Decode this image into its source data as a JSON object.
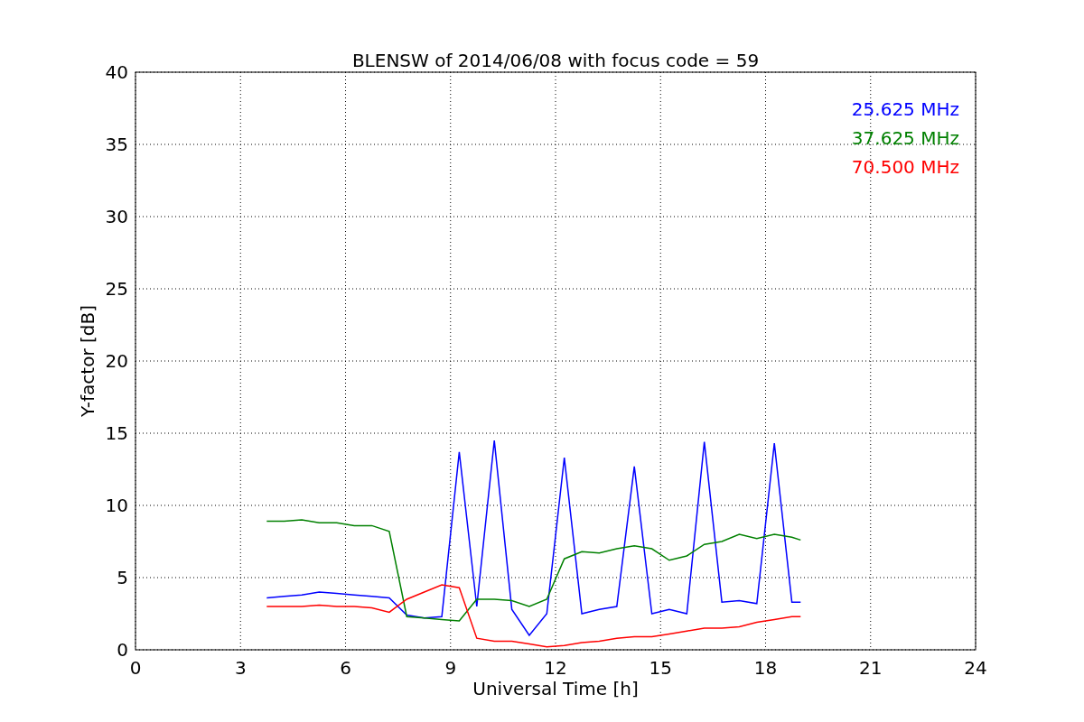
{
  "chart": {
    "chart_data": {
      "type": "line",
      "title": "BLENSW of 2014/06/08 with focus code = 59",
      "xlabel": "Universal Time [h]",
      "ylabel": "Y-factor [dB]",
      "x": [
        3.75,
        4.25,
        4.75,
        5.25,
        5.75,
        6.25,
        6.75,
        7.25,
        7.75,
        8.25,
        8.75,
        9.25,
        9.75,
        10.25,
        10.75,
        11.25,
        11.75,
        12.25,
        12.75,
        13.25,
        13.75,
        14.25,
        14.75,
        15.25,
        15.75,
        16.25,
        16.75,
        17.25,
        17.75,
        18.25,
        18.75,
        19
      ],
      "series": [
        {
          "name": "25.625 MHz",
          "color": "#0000ff",
          "values": [
            3.6,
            3.7,
            3.8,
            4.0,
            3.9,
            3.8,
            3.7,
            3.6,
            2.4,
            2.2,
            2.3,
            13.7,
            3.0,
            14.5,
            2.8,
            1.0,
            2.5,
            13.3,
            2.5,
            2.8,
            3.0,
            12.7,
            2.5,
            2.8,
            2.5,
            14.4,
            3.3,
            3.4,
            3.2,
            14.3,
            3.3,
            3.3
          ]
        },
        {
          "name": "37.625 MHz",
          "color": "#008000",
          "values": [
            8.9,
            8.9,
            9.0,
            8.8,
            8.8,
            8.6,
            8.6,
            8.2,
            2.3,
            2.2,
            2.1,
            2.0,
            3.5,
            3.5,
            3.4,
            3.0,
            3.5,
            6.3,
            6.8,
            6.7,
            7.0,
            7.2,
            7.0,
            6.2,
            6.5,
            7.3,
            7.5,
            8.0,
            7.7,
            8.0,
            7.8,
            7.6
          ]
        },
        {
          "name": "70.500 MHz",
          "color": "#ff0000",
          "values": [
            3.0,
            3.0,
            3.0,
            3.1,
            3.0,
            3.0,
            2.9,
            2.6,
            3.5,
            4.0,
            4.5,
            4.3,
            0.8,
            0.6,
            0.6,
            0.4,
            0.2,
            0.3,
            0.5,
            0.6,
            0.8,
            0.9,
            0.9,
            1.1,
            1.3,
            1.5,
            1.5,
            1.6,
            1.9,
            2.1,
            2.3,
            2.3
          ]
        }
      ],
      "xlim": [
        0,
        24
      ],
      "ylim": [
        0,
        40
      ],
      "xticks": [
        0,
        3,
        6,
        9,
        12,
        15,
        18,
        21,
        24
      ],
      "yticks": [
        0,
        5,
        10,
        15,
        20,
        25,
        30,
        35,
        40
      ],
      "grid": true
    }
  }
}
